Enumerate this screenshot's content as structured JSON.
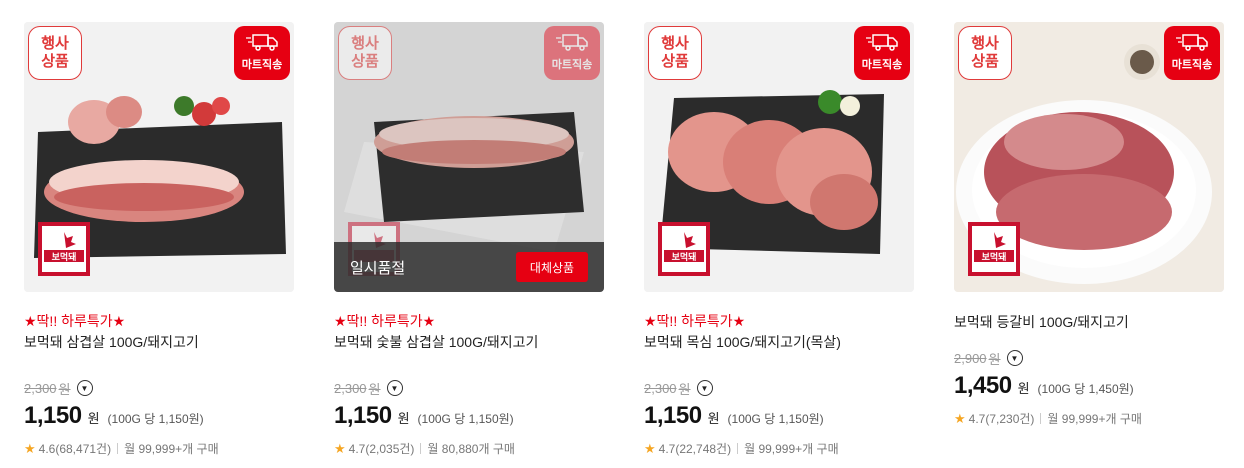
{
  "badges": {
    "event_line1": "행사",
    "event_line2": "상품",
    "mart_delivery": "마트직송",
    "brand_logo": "보먹돼"
  },
  "products": [
    {
      "promo": "★딱!! 하루특가★",
      "title": "보먹돼 삼겹살 100G/돼지고기",
      "original_price": "2,300",
      "price": "1,150",
      "currency": "원",
      "unit_price": "(100G 당 1,150원)",
      "rating": "4.6(68,471건)",
      "monthly": "월 99,999+개 구매",
      "sold_out": false
    },
    {
      "promo": "★딱!! 하루특가★",
      "title": "보먹돼 숯불 삼겹살 100G/돼지고기",
      "original_price": "2,300",
      "price": "1,150",
      "currency": "원",
      "unit_price": "(100G 당 1,150원)",
      "rating": "4.7(2,035건)",
      "monthly": "월 80,880개 구매",
      "sold_out": true,
      "sold_out_text": "일시품절",
      "substitute_label": "대체상품"
    },
    {
      "promo": "★딱!! 하루특가★",
      "title": "보먹돼 목심 100G/돼지고기(목살)",
      "original_price": "2,300",
      "price": "1,150",
      "currency": "원",
      "unit_price": "(100G 당 1,150원)",
      "rating": "4.7(22,748건)",
      "monthly": "월 99,999+개 구매",
      "sold_out": false
    },
    {
      "promo": "",
      "title": "보먹돼 등갈비 100G/돼지고기",
      "original_price": "2,900",
      "price": "1,450",
      "currency": "원",
      "unit_price": "(100G 당 1,450원)",
      "rating": "4.7(7,230건)",
      "monthly": "월 99,999+개 구매",
      "sold_out": false
    }
  ],
  "colors": {
    "accent_red": "#e60012",
    "star": "#f5a623",
    "slate": "#2b2b2b"
  }
}
